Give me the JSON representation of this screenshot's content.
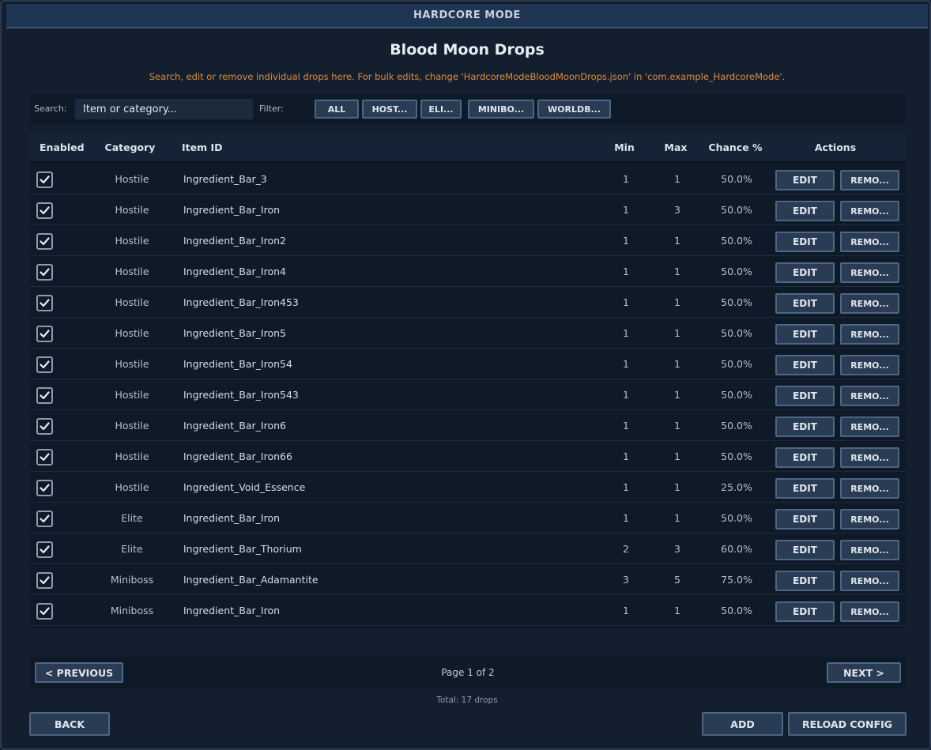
{
  "window": {
    "title": "HARDCORE MODE"
  },
  "page": {
    "title": "Blood Moon Drops",
    "subtitle": "Search, edit or remove individual drops here. For bulk edits, change 'HardcoreModeBloodMoonDrops.json' in 'com.example_HardcoreMode'."
  },
  "search": {
    "label": "Search:",
    "placeholder": "Item or category...",
    "value": ""
  },
  "filter": {
    "label": "Filter:",
    "buttons": [
      "ALL",
      "HOST...",
      "ELI...",
      "MINIBO...",
      "WORLDB..."
    ]
  },
  "table": {
    "headers": {
      "enabled": "Enabled",
      "category": "Category",
      "item_id": "Item ID",
      "min": "Min",
      "max": "Max",
      "chance": "Chance %",
      "actions": "Actions"
    },
    "edit_label": "EDIT",
    "remove_label": "REMO...",
    "rows": [
      {
        "enabled": true,
        "category": "Hostile",
        "item_id": "Ingredient_Bar_3",
        "min": "1",
        "max": "1",
        "chance": "50.0%"
      },
      {
        "enabled": true,
        "category": "Hostile",
        "item_id": "Ingredient_Bar_Iron",
        "min": "1",
        "max": "3",
        "chance": "50.0%"
      },
      {
        "enabled": true,
        "category": "Hostile",
        "item_id": "Ingredient_Bar_Iron2",
        "min": "1",
        "max": "1",
        "chance": "50.0%"
      },
      {
        "enabled": true,
        "category": "Hostile",
        "item_id": "Ingredient_Bar_Iron4",
        "min": "1",
        "max": "1",
        "chance": "50.0%"
      },
      {
        "enabled": true,
        "category": "Hostile",
        "item_id": "Ingredient_Bar_Iron453",
        "min": "1",
        "max": "1",
        "chance": "50.0%"
      },
      {
        "enabled": true,
        "category": "Hostile",
        "item_id": "Ingredient_Bar_Iron5",
        "min": "1",
        "max": "1",
        "chance": "50.0%"
      },
      {
        "enabled": true,
        "category": "Hostile",
        "item_id": "Ingredient_Bar_Iron54",
        "min": "1",
        "max": "1",
        "chance": "50.0%"
      },
      {
        "enabled": true,
        "category": "Hostile",
        "item_id": "Ingredient_Bar_Iron543",
        "min": "1",
        "max": "1",
        "chance": "50.0%"
      },
      {
        "enabled": true,
        "category": "Hostile",
        "item_id": "Ingredient_Bar_Iron6",
        "min": "1",
        "max": "1",
        "chance": "50.0%"
      },
      {
        "enabled": true,
        "category": "Hostile",
        "item_id": "Ingredient_Bar_Iron66",
        "min": "1",
        "max": "1",
        "chance": "50.0%"
      },
      {
        "enabled": true,
        "category": "Hostile",
        "item_id": "Ingredient_Void_Essence",
        "min": "1",
        "max": "1",
        "chance": "25.0%"
      },
      {
        "enabled": true,
        "category": "Elite",
        "item_id": "Ingredient_Bar_Iron",
        "min": "1",
        "max": "1",
        "chance": "50.0%"
      },
      {
        "enabled": true,
        "category": "Elite",
        "item_id": "Ingredient_Bar_Thorium",
        "min": "2",
        "max": "3",
        "chance": "60.0%"
      },
      {
        "enabled": true,
        "category": "Miniboss",
        "item_id": "Ingredient_Bar_Adamantite",
        "min": "3",
        "max": "5",
        "chance": "75.0%"
      },
      {
        "enabled": true,
        "category": "Miniboss",
        "item_id": "Ingredient_Bar_Iron",
        "min": "1",
        "max": "1",
        "chance": "50.0%"
      }
    ]
  },
  "pagination": {
    "previous_label": "< PREVIOUS",
    "page_info": "Page 1 of 2",
    "next_label": "NEXT >"
  },
  "footer": {
    "total": "Total: 17 drops",
    "back_label": "BACK",
    "add_label": "ADD",
    "reload_label": "RELOAD CONFIG"
  },
  "colors": {
    "accent_text": "#e08a3a",
    "button_bg": "#2a3c54",
    "button_border": "#4d6684",
    "titlebar_bg": "#1f3552"
  }
}
